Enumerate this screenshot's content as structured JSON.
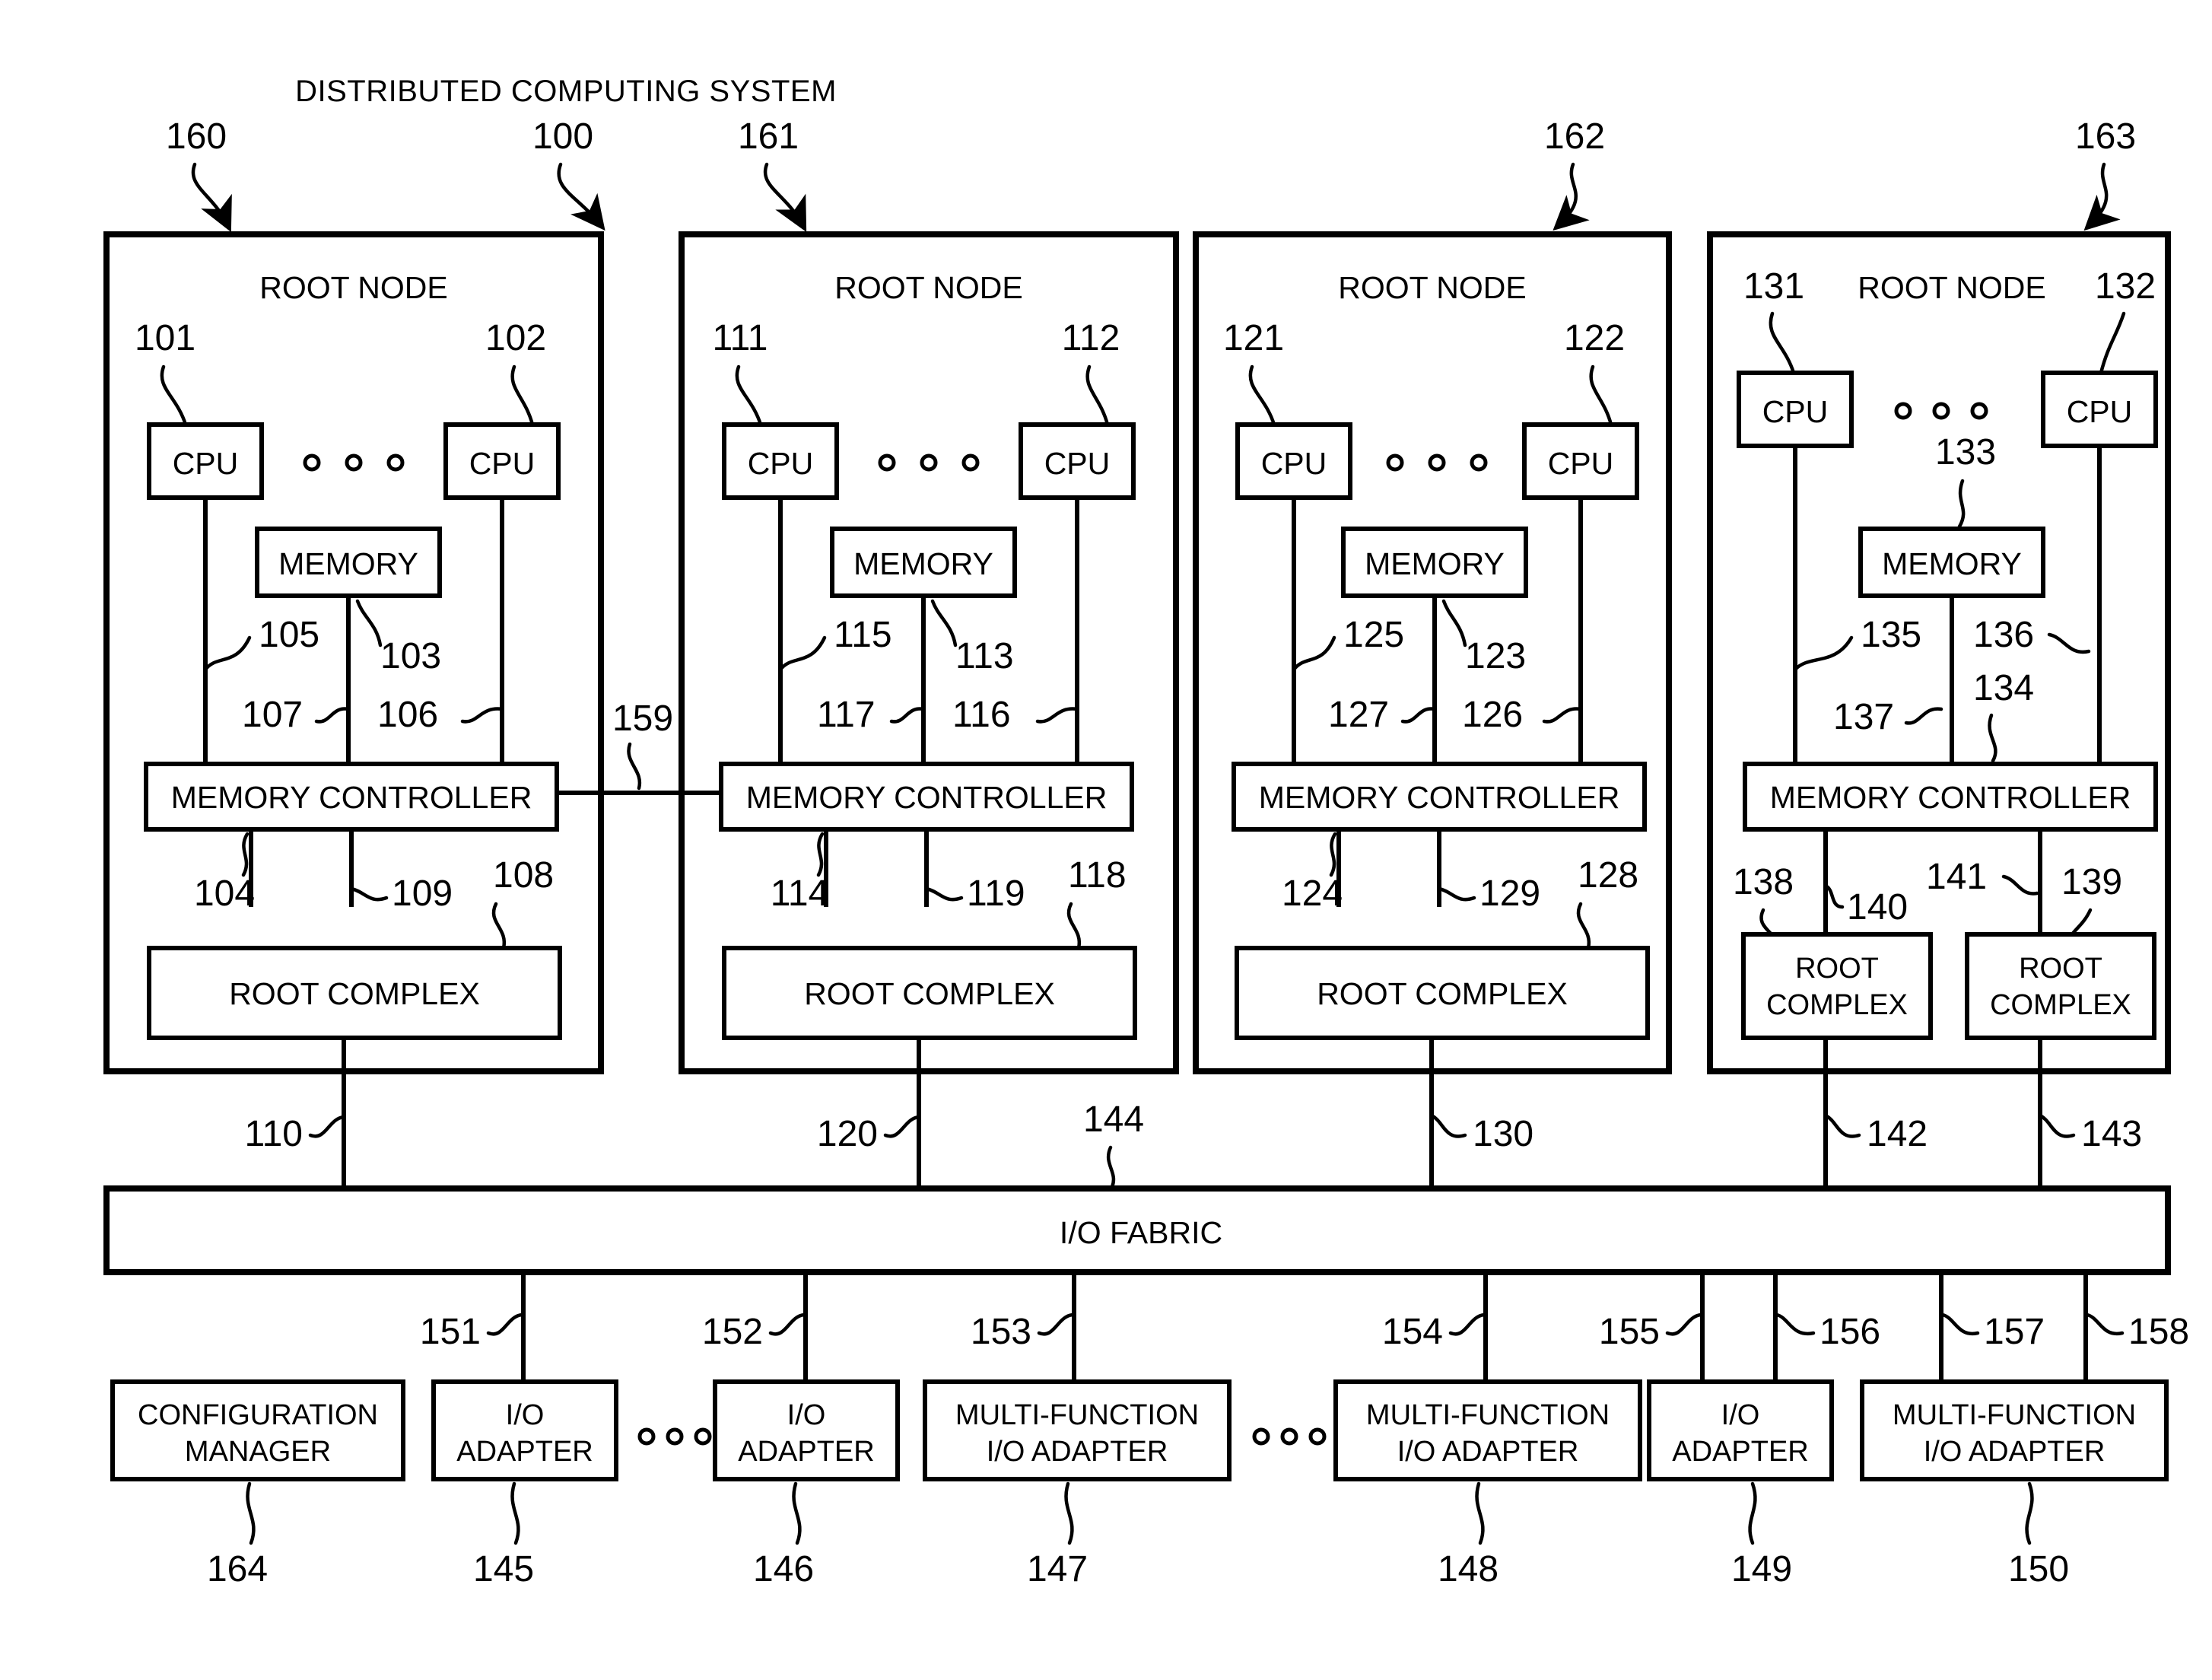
{
  "figure": {
    "title": "DISTRIBUTED COMPUTING SYSTEM",
    "system_ref": "100"
  },
  "labels": {
    "root_node": "ROOT NODE",
    "cpu": "CPU",
    "memory": "MEMORY",
    "memory_controller": "MEMORY CONTROLLER",
    "root_complex": "ROOT COMPLEX",
    "root_complex_l1": "ROOT",
    "root_complex_l2": "COMPLEX",
    "io_fabric": "I/O FABRIC",
    "io_adapter_l1": "I/O",
    "io_adapter_l2": "ADAPTER",
    "mf_adapter_l1": "MULTI-FUNCTION",
    "mf_adapter_l2": "I/O ADAPTER",
    "config_manager_l1": "CONFIGURATION",
    "config_manager_l2": "MANAGER"
  },
  "root_nodes": [
    {
      "node_ref": "160",
      "cpu_left_ref": "101",
      "cpu_right_ref": "102",
      "memory_ref": "103",
      "mc_bus_left_ref": "105",
      "mc_bus_right_ref": "106",
      "mc_bus_mid_ref": "107",
      "mc_ref": "104",
      "rc_bus_ref": "109",
      "rc_ref": "108",
      "fabric_link_ref": "110"
    },
    {
      "node_ref": "161",
      "cpu_left_ref": "111",
      "cpu_right_ref": "112",
      "memory_ref": "113",
      "mc_bus_left_ref": "115",
      "mc_bus_right_ref": "116",
      "mc_bus_mid_ref": "117",
      "mc_ref": "114",
      "rc_bus_ref": "119",
      "rc_ref": "118",
      "fabric_link_ref": "120"
    },
    {
      "node_ref": "162",
      "cpu_left_ref": "121",
      "cpu_right_ref": "122",
      "memory_ref": "123",
      "mc_bus_left_ref": "125",
      "mc_bus_right_ref": "126",
      "mc_bus_mid_ref": "127",
      "mc_ref": "124",
      "rc_bus_ref": "129",
      "rc_ref": "128",
      "fabric_link_ref": "130"
    },
    {
      "node_ref": "163",
      "cpu_left_ref": "131",
      "cpu_right_ref": "132",
      "memory_ref": "133",
      "mc_bus_left_ref": "135",
      "mc_bus_right_ref": "136",
      "mc_bus_mid_ref": "137",
      "mc_ref": "134",
      "rc_left_ref": "138",
      "rc_right_ref": "139",
      "rc_bus_left_ref": "140",
      "rc_bus_right_ref": "141",
      "fabric_link_left_ref": "142",
      "fabric_link_right_ref": "143"
    }
  ],
  "interconnect": {
    "node1_node2_link_ref": "159"
  },
  "io_fabric": {
    "ref": "144"
  },
  "adapters": [
    {
      "kind": "configuration-manager",
      "ref": "164",
      "link_ref": null
    },
    {
      "kind": "io-adapter",
      "ref": "145",
      "link_ref": "151"
    },
    {
      "kind": "io-adapter",
      "ref": "146",
      "link_ref": "152"
    },
    {
      "kind": "multi-function-io-adapter",
      "ref": "147",
      "link_ref": "153"
    },
    {
      "kind": "multi-function-io-adapter",
      "ref": "148",
      "link_ref": "154"
    },
    {
      "kind": "io-adapter",
      "ref": "149",
      "link_refs": [
        "155",
        "156"
      ]
    },
    {
      "kind": "multi-function-io-adapter",
      "ref": "150",
      "link_refs": [
        "157",
        "158"
      ]
    }
  ],
  "colors": {
    "stroke": "#000000",
    "background": "#ffffff"
  }
}
